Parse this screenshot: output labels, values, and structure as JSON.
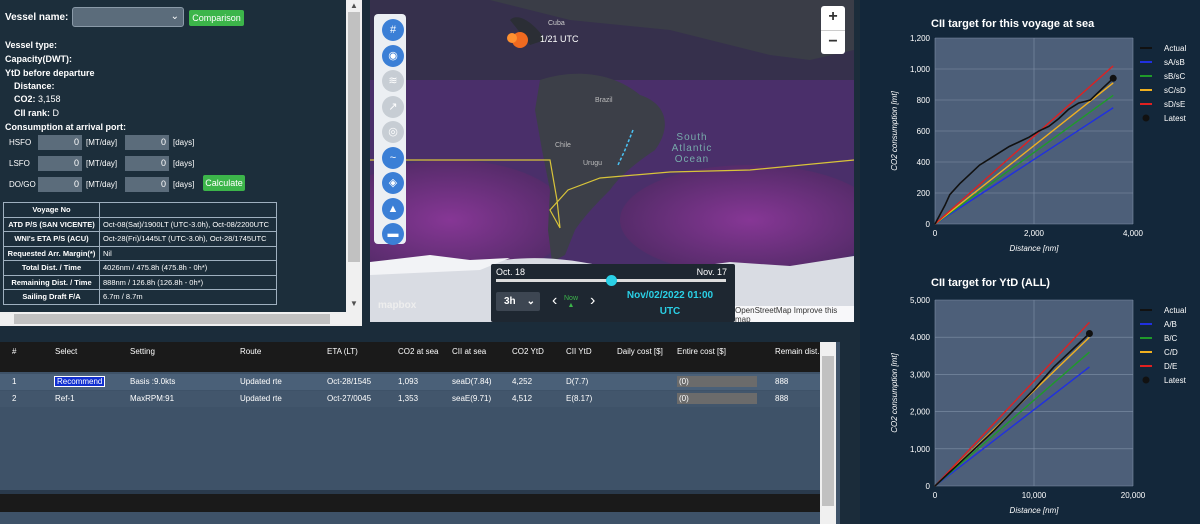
{
  "left": {
    "vessel_name_label": "Vessel name:",
    "comparison_btn": "Comparison",
    "vessel_type": "Vessel type:",
    "capacity": "Capacity(DWT):",
    "ytd": "YtD before departure",
    "distance": "Distance:",
    "co2_label": "CO2:",
    "co2_value": "3,158",
    "cii_label": "CII rank:",
    "cii_value": "D",
    "consumption": "Consumption at arrival port:",
    "fuels": [
      {
        "name": "HSFO",
        "mt": "0",
        "days": "0"
      },
      {
        "name": "LSFO",
        "mt": "0",
        "days": "0"
      },
      {
        "name": "DO/GO",
        "mt": "0",
        "days": "0"
      }
    ],
    "mt_unit": "[MT/day]",
    "day_unit": "[days]",
    "calculate_btn": "Calculate",
    "voyage_table": [
      {
        "k": "Voyage No",
        "v": ""
      },
      {
        "k": "ATD P/S (SAN VICENTE)",
        "v": "Oct-08(Sat)/1900LT (UTC-3.0h), Oct-08/2200UTC"
      },
      {
        "k": "WNI's ETA P/S (ACU)",
        "v": "Oct-28(Fri)/1445LT (UTC-3.0h), Oct-28/1745UTC"
      },
      {
        "k": "Requested Arr. Margin(*)",
        "v": "Nil"
      },
      {
        "k": "Total Dist. / Time",
        "v": "4026nm / 475.8h (475.8h - 0h*)"
      },
      {
        "k": "Remaining Dist. / Time",
        "v": "888nm / 126.8h (126.8h - 0h*)"
      },
      {
        "k": "Sailing Draft F/A",
        "v": "6.7m / 8.7m"
      }
    ]
  },
  "map": {
    "ship_label": "1/21 UTC",
    "labels": {
      "cuba": "Cuba",
      "brazil": "Brazil",
      "chile": "Chile",
      "uruguay": "Urugu",
      "ocean": "South Atlantic Ocean"
    },
    "timeline": {
      "start": "Oct. 18",
      "end": "Nov. 17",
      "step": "3h",
      "now": "Now",
      "datetime": "Nov/02/2022 01:00",
      "tz": "UTC",
      "position": 0.5
    },
    "attribution": "OpenStreetMap",
    "improve": "Improve this map",
    "logo": "mapbox",
    "zoom_in": "+",
    "zoom_out": "−"
  },
  "table": {
    "headers": [
      "#",
      "Select",
      "Setting",
      "Route",
      "ETA (LT)",
      "CO2 at sea",
      "CII at sea",
      "CO2 YtD",
      "CII YtD",
      "Daily cost [$]",
      "Entire cost [$]",
      "Remain dist."
    ],
    "rows": [
      {
        "n": "1",
        "select": "Recommend",
        "setting": "Basis :9.0kts",
        "route": "Updated rte",
        "eta": "Oct-28/1545",
        "co2sea": "1,093",
        "ciisea": "seaD(7.84)",
        "co2ytd": "4,252",
        "ciiytd": "D(7.7)",
        "daily": "",
        "entire": "(0)",
        "remain": "888"
      },
      {
        "n": "2",
        "select": "Ref-1",
        "setting": "MaxRPM:91",
        "route": "Updated rte",
        "eta": "Oct-27/0045",
        "co2sea": "1,353",
        "ciisea": "seaE(9.71)",
        "co2ytd": "4,512",
        "ciiytd": "E(8.17)",
        "daily": "",
        "entire": "(0)",
        "remain": "888"
      }
    ]
  },
  "chart_data": [
    {
      "type": "line",
      "title": "CII target for this voyage at sea",
      "xlabel": "Distance [nm]",
      "ylabel": "CO2 consumption [mt]",
      "xlim": [
        0,
        4000
      ],
      "ylim": [
        0,
        1200
      ],
      "xticks": [
        "0",
        "2,000",
        "4,000"
      ],
      "yticks": [
        "0",
        "200",
        "400",
        "600",
        "800",
        "1,000",
        "1,200"
      ],
      "legend_position": "right",
      "series": [
        {
          "name": "Actual",
          "color": "#111111",
          "x": [
            0,
            200,
            300,
            500,
            700,
            900,
            1100,
            1300,
            1500,
            1700,
            1900,
            2100,
            2300,
            2500,
            2700,
            2900,
            3138,
            3400,
            3600
          ],
          "y": [
            0,
            120,
            190,
            260,
            320,
            380,
            420,
            460,
            500,
            530,
            560,
            600,
            630,
            680,
            740,
            780,
            800,
            880,
            940
          ]
        },
        {
          "name": "sA/sB",
          "color": "#2030e0",
          "x": [
            0,
            3600
          ],
          "y": [
            0,
            750
          ]
        },
        {
          "name": "sB/sC",
          "color": "#1f9a2a",
          "x": [
            0,
            3600
          ],
          "y": [
            0,
            830
          ]
        },
        {
          "name": "sC/sD",
          "color": "#f0b020",
          "x": [
            0,
            3600
          ],
          "y": [
            0,
            910
          ]
        },
        {
          "name": "sD/sE",
          "color": "#e02020",
          "x": [
            0,
            3600
          ],
          "y": [
            0,
            1020
          ]
        }
      ],
      "latest": {
        "name": "Latest",
        "x": 3600,
        "y": 940
      }
    },
    {
      "type": "line",
      "title": "CII target for YtD (ALL)",
      "xlabel": "Distance [nm]",
      "ylabel": "CO2 consumption [mt]",
      "xlim": [
        0,
        20000
      ],
      "ylim": [
        0,
        5000
      ],
      "xticks": [
        "0",
        "10,000",
        "20,000"
      ],
      "yticks": [
        "0",
        "1,000",
        "2,000",
        "3,000",
        "4,000",
        "5,000"
      ],
      "legend_position": "right",
      "series": [
        {
          "name": "Actual",
          "color": "#111111",
          "x": [
            0,
            2000,
            4000,
            6000,
            8000,
            10000,
            12000,
            14000,
            15600
          ],
          "y": [
            0,
            500,
            1000,
            1500,
            2050,
            2600,
            3200,
            3700,
            4100
          ]
        },
        {
          "name": "A/B",
          "color": "#2030e0",
          "x": [
            0,
            15600
          ],
          "y": [
            0,
            3200
          ]
        },
        {
          "name": "B/C",
          "color": "#1f9a2a",
          "x": [
            0,
            15600
          ],
          "y": [
            0,
            3600
          ]
        },
        {
          "name": "C/D",
          "color": "#f0b020",
          "x": [
            0,
            15600
          ],
          "y": [
            0,
            4000
          ]
        },
        {
          "name": "D/E",
          "color": "#e02020",
          "x": [
            0,
            15600
          ],
          "y": [
            0,
            4400
          ]
        }
      ],
      "latest": {
        "name": "Latest",
        "x": 15600,
        "y": 4100
      }
    }
  ]
}
